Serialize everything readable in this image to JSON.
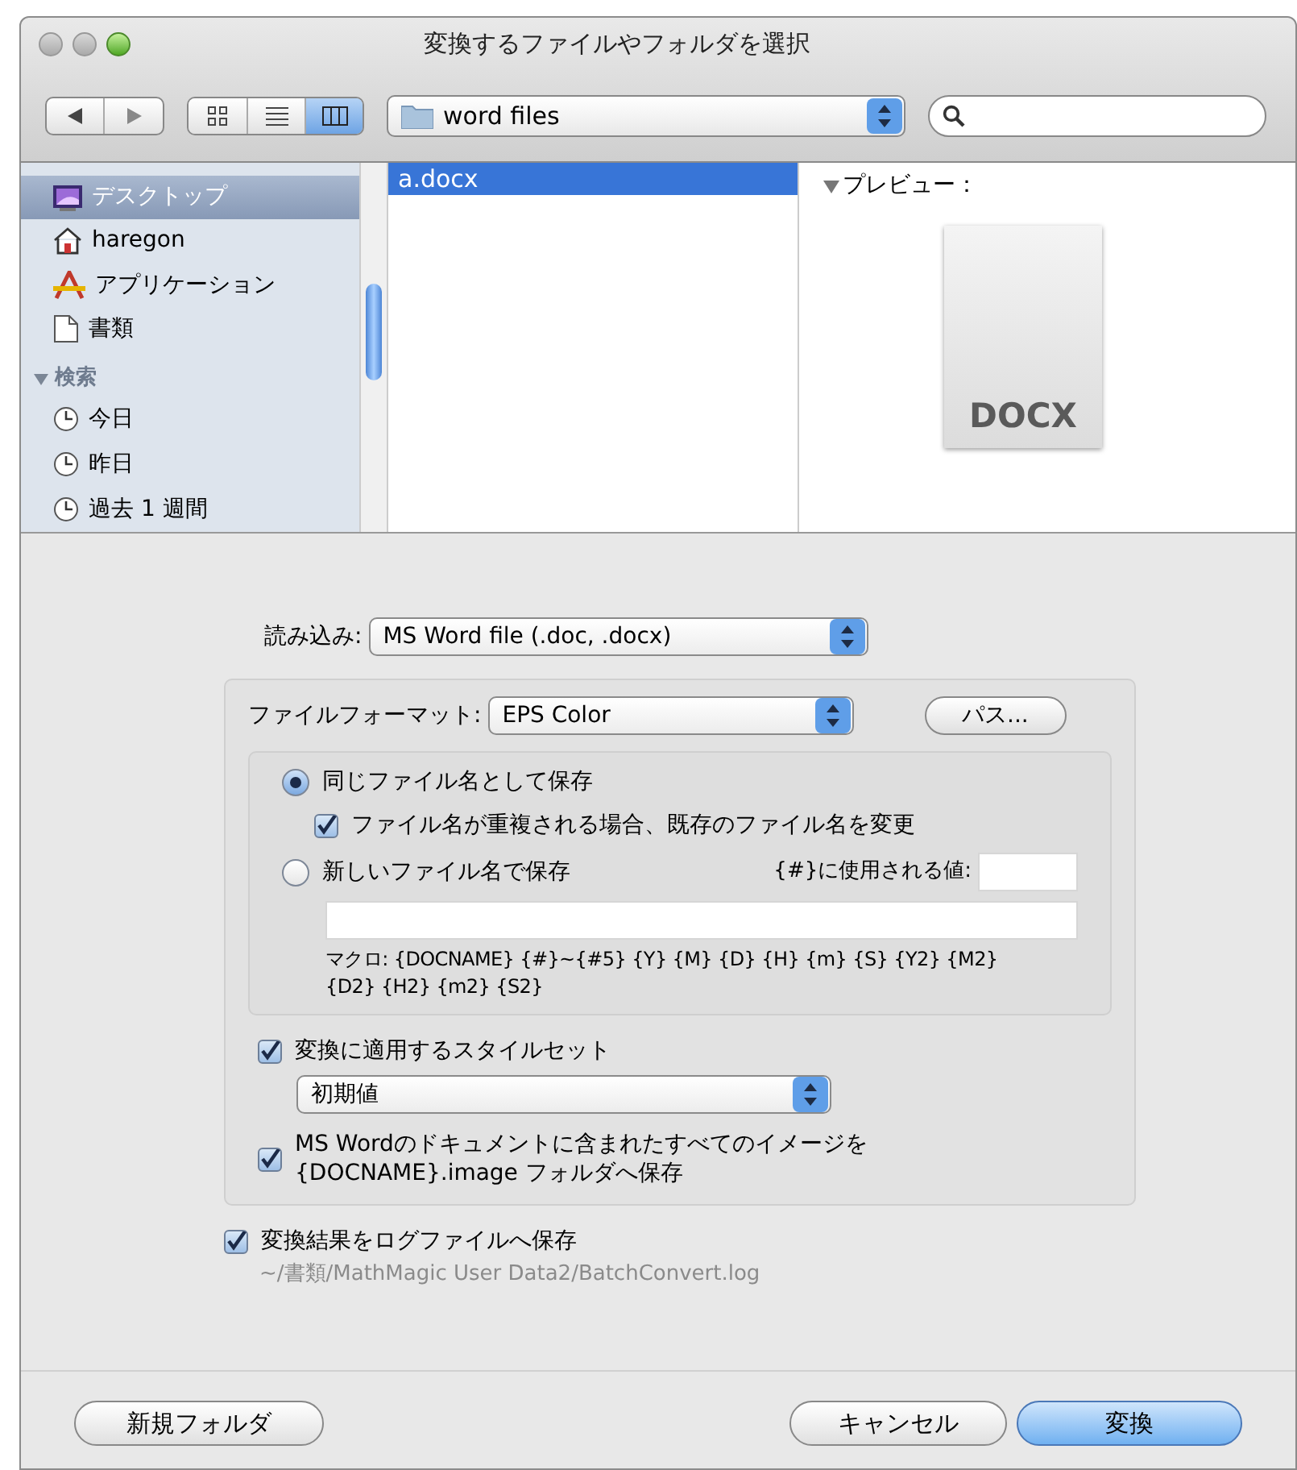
{
  "window": {
    "title": "変換するファイルやフォルダを選択"
  },
  "toolbar": {
    "view_modes": [
      {
        "kind": "icons",
        "selected": false
      },
      {
        "kind": "list",
        "selected": false
      },
      {
        "kind": "columns",
        "selected": true
      }
    ],
    "location": "word files"
  },
  "sidebar": {
    "items": [
      {
        "label": "デスクトップ",
        "kind": "desktop",
        "selected": true
      },
      {
        "label": "haregon",
        "kind": "home",
        "selected": false
      },
      {
        "label": "アプリケーション",
        "kind": "apps",
        "selected": false
      },
      {
        "label": "書類",
        "kind": "documents",
        "selected": false
      },
      {
        "label": "検索",
        "kind": "header",
        "expanded": true,
        "children": [
          {
            "label": "今日",
            "kind": "clock",
            "selected": false
          },
          {
            "label": "昨日",
            "kind": "clock",
            "selected": false
          },
          {
            "label": "過去 1 週間",
            "kind": "clock",
            "selected": false
          }
        ]
      }
    ]
  },
  "files": [
    {
      "name": "a.docx",
      "selected": true
    }
  ],
  "preview": {
    "label": "プレビュー：",
    "expanded": true,
    "document_label": "DOCX"
  },
  "import": {
    "label": "読み込み:",
    "value": "MS Word file (.doc, .docx)"
  },
  "format": {
    "label": "ファイルフォーマット:",
    "value": "EPS Color",
    "button": "パス..."
  },
  "naming": {
    "options": [
      {
        "label": "同じファイル名として保存",
        "selected": true
      },
      {
        "label": "新しいファイル名で保存",
        "selected": false
      }
    ],
    "rename_checkbox": {
      "label": "ファイル名が重複される場合、既存のファイル名を変更",
      "checked": true
    },
    "counter_label": "{#}に使用される値:",
    "macro_note": "マクロ: {DOCNAME} {#}~{#5} {Y} {M} {D} {H} {m} {S} {Y2} {M2}\n{D2} {H2} {m2} {S2}"
  },
  "style_set": {
    "label": "変換に適用するスタイルセット",
    "checked": true,
    "value": "初期値"
  },
  "save_images": {
    "label": "MS Wordのドキュメントに含まれたすべてのイメージを\n{DOCNAME}.image フォルダへ保存",
    "checked": true
  },
  "log": {
    "label": "変換結果をログファイルへ保存",
    "checked": true,
    "path": "~/書類/MathMagic User Data2/BatchConvert.log"
  },
  "buttons": {
    "new_folder": "新規フォルダ",
    "cancel": "キャンセル",
    "convert": "変換"
  }
}
